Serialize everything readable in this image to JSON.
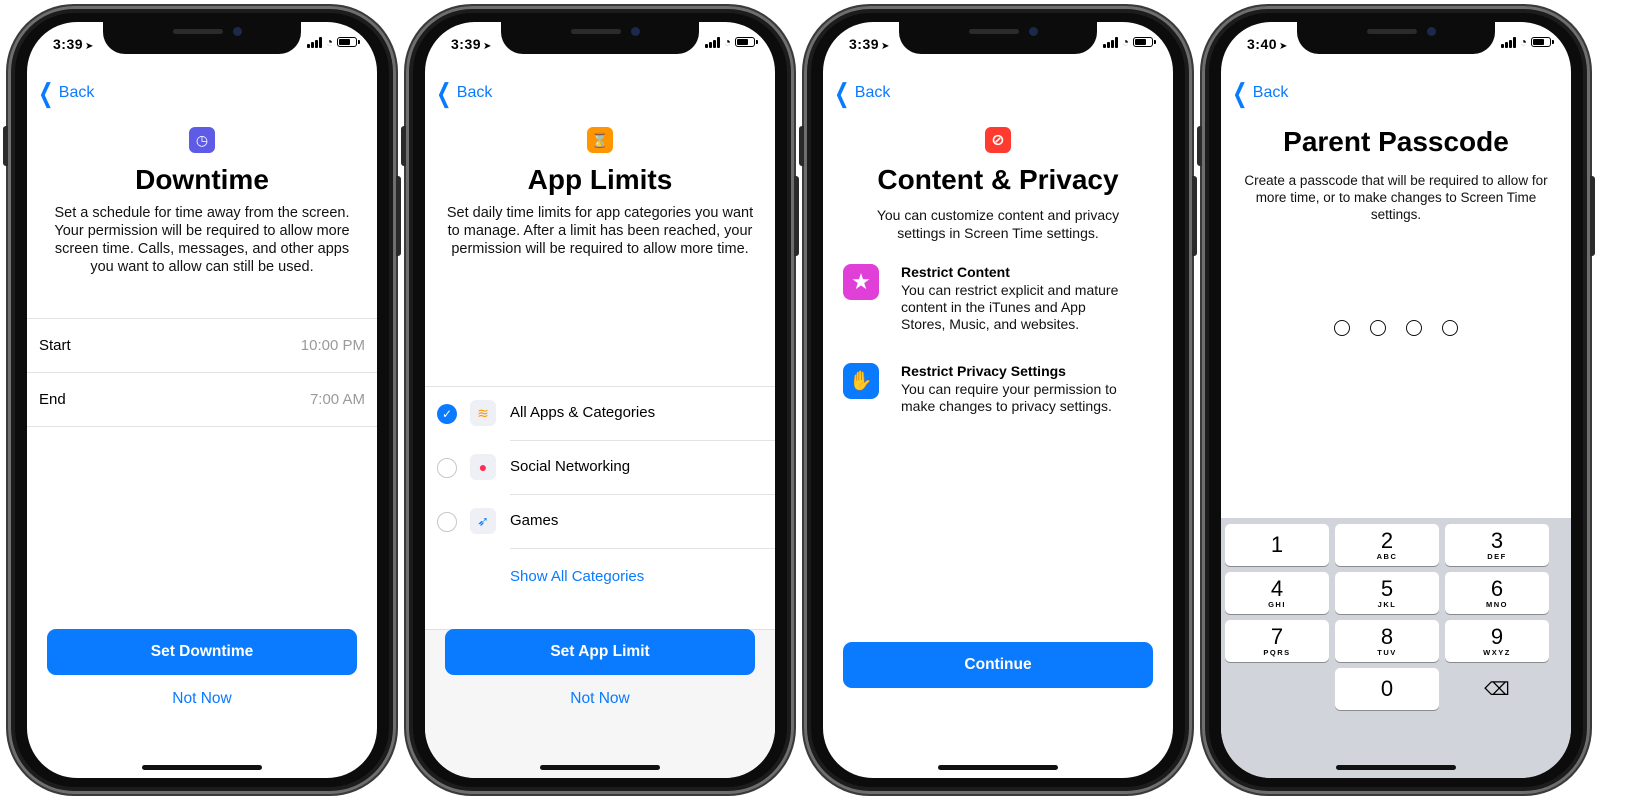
{
  "phones": [
    {
      "status": {
        "time": "3:39"
      },
      "nav": {
        "back": "Back"
      },
      "icon": {
        "name": "downtime-icon",
        "color": "#5e5ce6",
        "glyph": "◷"
      },
      "title": "Downtime",
      "description": "Set a schedule for time away from the screen. Your permission will be required to allow more screen time. Calls, messages, and other apps you want to allow can still be used.",
      "rows": [
        {
          "label": "Start",
          "value": "10:00 PM"
        },
        {
          "label": "End",
          "value": "7:00 AM"
        }
      ],
      "primary_button": "Set Downtime",
      "secondary_button": "Not Now"
    },
    {
      "status": {
        "time": "3:39"
      },
      "nav": {
        "back": "Back"
      },
      "icon": {
        "name": "hourglass-icon",
        "color": "#ff9500",
        "glyph": "⌛"
      },
      "title": "App Limits",
      "description": "Set daily time limits for app categories you want to manage. After a limit has been reached, your permission will be required to allow more time.",
      "categories": [
        {
          "label": "All Apps & Categories",
          "selected": true,
          "icon": "stack-icon",
          "glyph": "≋"
        },
        {
          "label": "Social Networking",
          "selected": false,
          "icon": "chat-bubble-icon",
          "glyph": "●"
        },
        {
          "label": "Games",
          "selected": false,
          "icon": "rocket-icon",
          "glyph": "➶"
        }
      ],
      "show_all": "Show All Categories",
      "primary_button": "Set App Limit",
      "secondary_button": "Not Now"
    },
    {
      "status": {
        "time": "3:39"
      },
      "nav": {
        "back": "Back"
      },
      "icon": {
        "name": "no-entry-icon",
        "color": "#ff3b30",
        "glyph": "⊘"
      },
      "title": "Content & Privacy",
      "description": "You can customize content and privacy settings in Screen Time settings.",
      "features": [
        {
          "title": "Restrict Content",
          "text": "You can restrict explicit and mature content in the iTunes and App Stores, Music, and websites.",
          "icon": "star-icon",
          "color": "#e040d8",
          "glyph": "★"
        },
        {
          "title": "Restrict Privacy Settings",
          "text": "You can require your permission to make changes to privacy settings.",
          "icon": "hand-icon",
          "color": "#0a7aff",
          "glyph": "✋"
        }
      ],
      "primary_button": "Continue"
    },
    {
      "status": {
        "time": "3:40"
      },
      "nav": {
        "back": "Back"
      },
      "title": "Parent Passcode",
      "description": "Create a passcode that will be required to allow for more time, or to make changes to Screen Time settings.",
      "passcode_length": 4,
      "keys": [
        {
          "num": "1",
          "letters": ""
        },
        {
          "num": "2",
          "letters": "ABC"
        },
        {
          "num": "3",
          "letters": "DEF"
        },
        {
          "num": "4",
          "letters": "GHI"
        },
        {
          "num": "5",
          "letters": "JKL"
        },
        {
          "num": "6",
          "letters": "MNO"
        },
        {
          "num": "7",
          "letters": "PQRS"
        },
        {
          "num": "8",
          "letters": "TUV"
        },
        {
          "num": "9",
          "letters": "WXYZ"
        },
        {
          "num": "0",
          "letters": ""
        }
      ],
      "delete_key": "⌫"
    }
  ]
}
